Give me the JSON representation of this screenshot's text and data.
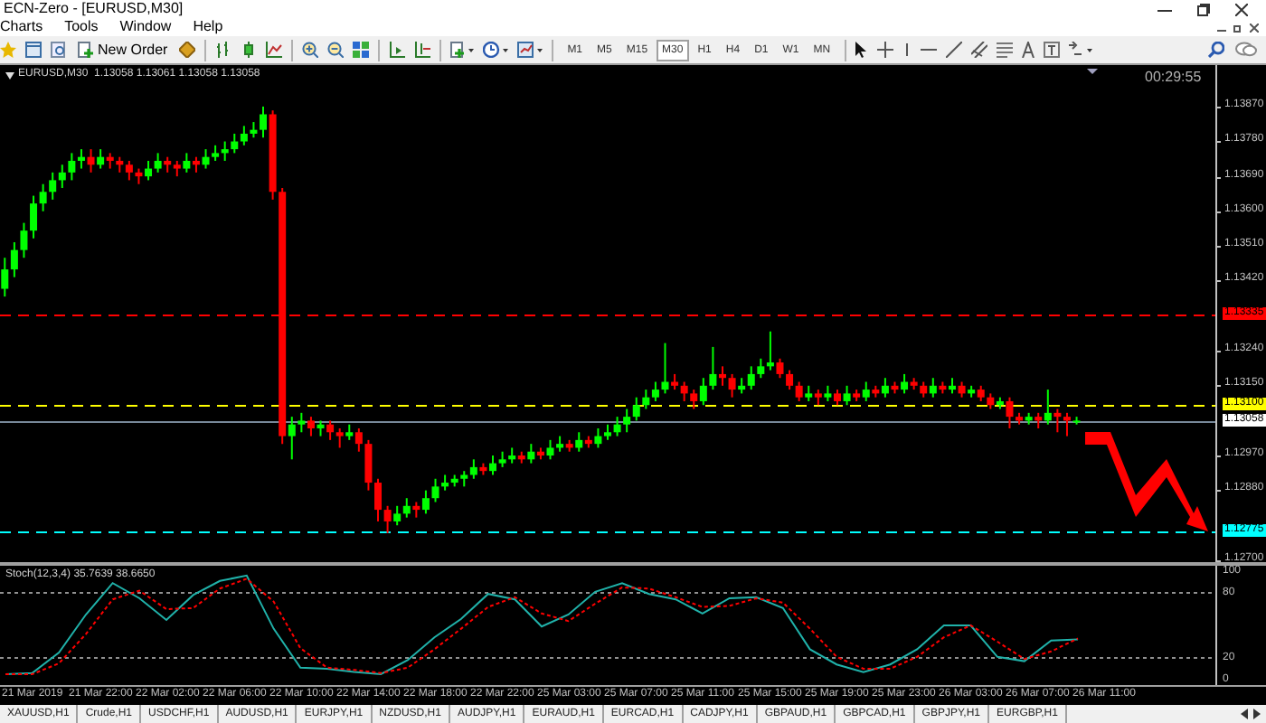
{
  "window": {
    "title": "ECN-Zero - [EURUSD,M30]"
  },
  "menu": [
    "Charts",
    "Tools",
    "Window",
    "Help"
  ],
  "toolbar": {
    "new_order": "New Order",
    "timeframes": [
      {
        "label": "M1",
        "selected": false
      },
      {
        "label": "M5",
        "selected": false
      },
      {
        "label": "M15",
        "selected": false
      },
      {
        "label": "M30",
        "selected": true
      },
      {
        "label": "H1",
        "selected": false
      },
      {
        "label": "H4",
        "selected": false
      },
      {
        "label": "D1",
        "selected": false
      },
      {
        "label": "W1",
        "selected": false
      },
      {
        "label": "MN",
        "selected": false
      }
    ]
  },
  "chart": {
    "header": "EURUSD,M30  1.13058 1.13061 1.13058 1.13058",
    "countdown": "00:29:55",
    "chart_data": {
      "type": "candlestick",
      "ylim": [
        1.12695,
        1.13977
      ],
      "ref_lines": [
        {
          "axis": "y",
          "value": 1.13335,
          "label": "1.13335",
          "color": "#ff0000",
          "line_style": "dashed"
        },
        {
          "axis": "y",
          "value": 1.131,
          "label": "1.13100",
          "color": "#ffff00",
          "line_style": "dashed"
        },
        {
          "axis": "y",
          "value": 1.13058,
          "label": "1.13058",
          "color": "#778899",
          "line_style": "solid"
        },
        {
          "axis": "y",
          "value": 1.12775,
          "label": "1.12775",
          "color": "#00ffff",
          "line_style": "dashed"
        }
      ],
      "yticks": [
        {
          "value": 1.1387,
          "label": "1.13870"
        },
        {
          "value": 1.1378,
          "label": "1.13780"
        },
        {
          "value": 1.1369,
          "label": "1.13690"
        },
        {
          "value": 1.136,
          "label": "1.13600"
        },
        {
          "value": 1.1351,
          "label": "1.13510"
        },
        {
          "value": 1.1342,
          "label": "1.13420"
        },
        {
          "value": 1.1324,
          "label": "1.13240"
        },
        {
          "value": 1.1315,
          "label": "1.13150"
        },
        {
          "value": 1.1297,
          "label": "1.12970"
        },
        {
          "value": 1.1288,
          "label": "1.12880"
        },
        {
          "value": 1.127,
          "label": "1.12700"
        }
      ],
      "categories": [
        null,
        null,
        null,
        null,
        null,
        null,
        null,
        null,
        null,
        null,
        null,
        null,
        null,
        null,
        null,
        null,
        null,
        null,
        null,
        null,
        null,
        null,
        null,
        null,
        null,
        null,
        null,
        null,
        null,
        null,
        null,
        null,
        null,
        null,
        null,
        null,
        null,
        null,
        null,
        null,
        null,
        null,
        null,
        null,
        null,
        null,
        null,
        null,
        null,
        null,
        null,
        null,
        null,
        null,
        null,
        null,
        null,
        null,
        null,
        null,
        null,
        null,
        null,
        null,
        null,
        null,
        null,
        null,
        null,
        null,
        null,
        null,
        null,
        null,
        null,
        null,
        null,
        null,
        null,
        null,
        null,
        null,
        null,
        null,
        null,
        null,
        null,
        null,
        null,
        null,
        null,
        null,
        null,
        null,
        null,
        null,
        null,
        null,
        null,
        null,
        null,
        null,
        null,
        null,
        null,
        null,
        null,
        null,
        null,
        null,
        null,
        null,
        null,
        null,
        null,
        null,
        null,
        null,
        null,
        null,
        null,
        null,
        null,
        null,
        null,
        null,
        null
      ],
      "ohlc": [
        [
          1.134,
          1.1348,
          1.1338,
          1.1345
        ],
        [
          1.1345,
          1.1352,
          1.1343,
          1.135
        ],
        [
          1.135,
          1.1357,
          1.1348,
          1.1355
        ],
        [
          1.1355,
          1.1364,
          1.1353,
          1.1362
        ],
        [
          1.1362,
          1.1367,
          1.136,
          1.1365
        ],
        [
          1.1365,
          1.137,
          1.1363,
          1.1368
        ],
        [
          1.1368,
          1.1372,
          1.1366,
          1.137
        ],
        [
          1.137,
          1.1375,
          1.1368,
          1.1373
        ],
        [
          1.1373,
          1.1376,
          1.1371,
          1.1374
        ],
        [
          1.1374,
          1.1376,
          1.137,
          1.1372
        ],
        [
          1.1372,
          1.1376,
          1.1371,
          1.1374
        ],
        [
          1.1374,
          1.1375,
          1.1371,
          1.1373
        ],
        [
          1.1373,
          1.1374,
          1.137,
          1.1372
        ],
        [
          1.1372,
          1.1373,
          1.1368,
          1.137
        ],
        [
          1.137,
          1.1371,
          1.1367,
          1.1369
        ],
        [
          1.1369,
          1.1373,
          1.1368,
          1.1371
        ],
        [
          1.1371,
          1.1375,
          1.137,
          1.1373
        ],
        [
          1.1373,
          1.1374,
          1.137,
          1.1372
        ],
        [
          1.1372,
          1.1373,
          1.1369,
          1.1371
        ],
        [
          1.1371,
          1.1375,
          1.137,
          1.1373
        ],
        [
          1.1373,
          1.1374,
          1.137,
          1.1372
        ],
        [
          1.1372,
          1.1376,
          1.1371,
          1.1374
        ],
        [
          1.1374,
          1.1377,
          1.1373,
          1.1375
        ],
        [
          1.1375,
          1.1378,
          1.1373,
          1.1376
        ],
        [
          1.1376,
          1.138,
          1.1375,
          1.1378
        ],
        [
          1.1378,
          1.1382,
          1.1377,
          1.138
        ],
        [
          1.138,
          1.1383,
          1.1379,
          1.1381
        ],
        [
          1.1381,
          1.1387,
          1.1379,
          1.1385
        ],
        [
          1.1385,
          1.1386,
          1.1363,
          1.1365
        ],
        [
          1.1365,
          1.1366,
          1.13,
          1.1302
        ],
        [
          1.1302,
          1.1307,
          1.1296,
          1.1305
        ],
        [
          1.1305,
          1.1308,
          1.1303,
          1.1306
        ],
        [
          1.1306,
          1.1307,
          1.1302,
          1.1304
        ],
        [
          1.1304,
          1.1306,
          1.1302,
          1.1305
        ],
        [
          1.1305,
          1.1306,
          1.1301,
          1.1303
        ],
        [
          1.1303,
          1.1304,
          1.1299,
          1.1302
        ],
        [
          1.1302,
          1.1305,
          1.1301,
          1.1303
        ],
        [
          1.1303,
          1.1304,
          1.1298,
          1.13
        ],
        [
          1.13,
          1.1301,
          1.1288,
          1.129
        ],
        [
          1.129,
          1.1291,
          1.128,
          1.1283
        ],
        [
          1.1283,
          1.1284,
          1.1277,
          1.128
        ],
        [
          1.128,
          1.1284,
          1.1279,
          1.1282
        ],
        [
          1.1282,
          1.1286,
          1.1281,
          1.1284
        ],
        [
          1.1284,
          1.1285,
          1.1281,
          1.1283
        ],
        [
          1.1283,
          1.1288,
          1.1282,
          1.1286
        ],
        [
          1.1286,
          1.1291,
          1.1285,
          1.1289
        ],
        [
          1.1289,
          1.1292,
          1.1288,
          1.129
        ],
        [
          1.129,
          1.1292,
          1.1289,
          1.1291
        ],
        [
          1.1291,
          1.1293,
          1.1289,
          1.1292
        ],
        [
          1.1292,
          1.1296,
          1.1291,
          1.1294
        ],
        [
          1.1294,
          1.1295,
          1.1292,
          1.1293
        ],
        [
          1.1293,
          1.1297,
          1.1292,
          1.1295
        ],
        [
          1.1295,
          1.1298,
          1.1294,
          1.1296
        ],
        [
          1.1296,
          1.1299,
          1.1295,
          1.1297
        ],
        [
          1.1297,
          1.1298,
          1.1295,
          1.1296
        ],
        [
          1.1296,
          1.13,
          1.1295,
          1.1298
        ],
        [
          1.1298,
          1.1299,
          1.1296,
          1.1297
        ],
        [
          1.1297,
          1.1301,
          1.1296,
          1.1299
        ],
        [
          1.1299,
          1.1302,
          1.1298,
          1.13
        ],
        [
          1.13,
          1.1301,
          1.1298,
          1.1299
        ],
        [
          1.1299,
          1.1303,
          1.1298,
          1.1301
        ],
        [
          1.1301,
          1.1302,
          1.1299,
          1.13
        ],
        [
          1.13,
          1.1304,
          1.1299,
          1.1302
        ],
        [
          1.1302,
          1.1305,
          1.1301,
          1.1303
        ],
        [
          1.1303,
          1.1307,
          1.1302,
          1.1305
        ],
        [
          1.1305,
          1.1309,
          1.1303,
          1.1307
        ],
        [
          1.1307,
          1.1312,
          1.1306,
          1.131
        ],
        [
          1.131,
          1.1314,
          1.1309,
          1.1312
        ],
        [
          1.1312,
          1.1316,
          1.1311,
          1.1314
        ],
        [
          1.1314,
          1.1326,
          1.1313,
          1.1316
        ],
        [
          1.1316,
          1.1318,
          1.1314,
          1.1315
        ],
        [
          1.1315,
          1.1316,
          1.1311,
          1.1313
        ],
        [
          1.1313,
          1.1314,
          1.1309,
          1.1311
        ],
        [
          1.1311,
          1.1317,
          1.131,
          1.1315
        ],
        [
          1.1315,
          1.1325,
          1.1314,
          1.1318
        ],
        [
          1.1318,
          1.132,
          1.1315,
          1.1317
        ],
        [
          1.1317,
          1.1318,
          1.1312,
          1.1314
        ],
        [
          1.1314,
          1.1317,
          1.1313,
          1.1315
        ],
        [
          1.1315,
          1.132,
          1.1314,
          1.1318
        ],
        [
          1.1318,
          1.1322,
          1.1317,
          1.132
        ],
        [
          1.132,
          1.1329,
          1.1319,
          1.1321
        ],
        [
          1.1321,
          1.1322,
          1.1317,
          1.1318
        ],
        [
          1.1318,
          1.1319,
          1.1314,
          1.1315
        ],
        [
          1.1315,
          1.1316,
          1.1311,
          1.1312
        ],
        [
          1.1312,
          1.1315,
          1.1311,
          1.1313
        ],
        [
          1.1313,
          1.1314,
          1.131,
          1.1312
        ],
        [
          1.1312,
          1.1315,
          1.1311,
          1.1313
        ],
        [
          1.1313,
          1.1314,
          1.131,
          1.1311
        ],
        [
          1.1311,
          1.1315,
          1.131,
          1.1313
        ],
        [
          1.1313,
          1.1314,
          1.1311,
          1.1312
        ],
        [
          1.1312,
          1.1316,
          1.1311,
          1.1314
        ],
        [
          1.1314,
          1.1315,
          1.1312,
          1.1313
        ],
        [
          1.1313,
          1.1317,
          1.1312,
          1.1315
        ],
        [
          1.1315,
          1.1316,
          1.1313,
          1.1314
        ],
        [
          1.1314,
          1.1318,
          1.1313,
          1.1316
        ],
        [
          1.1316,
          1.1317,
          1.1314,
          1.1315
        ],
        [
          1.1315,
          1.1316,
          1.1312,
          1.1313
        ],
        [
          1.1313,
          1.1317,
          1.1312,
          1.1315
        ],
        [
          1.1315,
          1.1316,
          1.1313,
          1.1314
        ],
        [
          1.1314,
          1.1317,
          1.1313,
          1.1315
        ],
        [
          1.1315,
          1.1316,
          1.1312,
          1.1313
        ],
        [
          1.1313,
          1.1315,
          1.1312,
          1.1314
        ],
        [
          1.1314,
          1.1315,
          1.1311,
          1.1312
        ],
        [
          1.1312,
          1.1313,
          1.1309,
          1.131
        ],
        [
          1.131,
          1.1312,
          1.1309,
          1.1311
        ],
        [
          1.1311,
          1.1312,
          1.1304,
          1.1307
        ],
        [
          1.1307,
          1.1308,
          1.1305,
          1.1306
        ],
        [
          1.1306,
          1.1308,
          1.1305,
          1.1307
        ],
        [
          1.1307,
          1.1308,
          1.1304,
          1.1306
        ],
        [
          1.1306,
          1.1314,
          1.1305,
          1.1308
        ],
        [
          1.1308,
          1.1309,
          1.1303,
          1.1307
        ],
        [
          1.1307,
          1.1308,
          1.1302,
          1.1306
        ],
        [
          1.1306,
          1.1307,
          1.1305,
          1.1306
        ],
        null,
        null,
        null,
        null,
        null,
        null,
        null,
        null,
        null,
        null,
        null,
        null,
        null,
        null
      ]
    }
  },
  "indicator": {
    "label": "Stoch(12,3,4) 35.7639 38.6650",
    "chart_data": {
      "type": "line",
      "ylim": [
        0,
        100
      ],
      "yticks": [
        {
          "value": 100,
          "label": "100"
        },
        {
          "value": 80,
          "label": "80"
        },
        {
          "value": 20,
          "label": "20"
        },
        {
          "value": 0,
          "label": "0"
        }
      ],
      "series": [
        {
          "color": "#20b2aa",
          "line_style": "solid",
          "values": [
            5,
            6,
            25,
            60,
            89,
            75,
            55,
            78,
            91,
            96,
            47,
            11,
            10,
            7,
            5,
            18,
            39,
            56,
            79,
            74,
            49,
            60,
            81,
            89,
            79,
            74,
            61,
            75,
            76,
            66,
            28,
            14,
            7,
            14,
            28,
            50,
            50,
            21,
            17,
            36,
            37
          ]
        },
        {
          "color": "#ff0000",
          "line_style": "dotted",
          "values": [
            5,
            5,
            15,
            42,
            74,
            82,
            65,
            66,
            84,
            93,
            72,
            29,
            11,
            9,
            6,
            11,
            28,
            47,
            67,
            76,
            61,
            54,
            70,
            85,
            84,
            76,
            67,
            68,
            75,
            71,
            47,
            21,
            10,
            10,
            21,
            39,
            50,
            35,
            19,
            26,
            38
          ]
        }
      ]
    }
  },
  "time_axis": [
    "21 Mar 2019",
    "21 Mar 22:00",
    "22 Mar 02:00",
    "22 Mar 06:00",
    "22 Mar 10:00",
    "22 Mar 14:00",
    "22 Mar 18:00",
    "22 Mar 22:00",
    "25 Mar 03:00",
    "25 Mar 07:00",
    "25 Mar 11:00",
    "25 Mar 15:00",
    "25 Mar 19:00",
    "25 Mar 23:00",
    "26 Mar 03:00",
    "26 Mar 07:00",
    "26 Mar 11:00"
  ],
  "tabs": [
    {
      "label": "XAUUSD,H1",
      "selected": false
    },
    {
      "label": "Crude,H1",
      "selected": false
    },
    {
      "label": "USDCHF,H1",
      "selected": false
    },
    {
      "label": "AUDUSD,H1",
      "selected": false
    },
    {
      "label": "EURJPY,H1",
      "selected": false
    },
    {
      "label": "NZDUSD,H1",
      "selected": false
    },
    {
      "label": "AUDJPY,H1",
      "selected": false
    },
    {
      "label": "EURAUD,H1",
      "selected": false
    },
    {
      "label": "EURCAD,H1",
      "selected": false
    },
    {
      "label": "CADJPY,H1",
      "selected": false
    },
    {
      "label": "GBPAUD,H1",
      "selected": false
    },
    {
      "label": "GBPCAD,H1",
      "selected": false
    },
    {
      "label": "GBPJPY,H1",
      "selected": false
    },
    {
      "label": "EURGBP,H1",
      "selected": false
    }
  ]
}
